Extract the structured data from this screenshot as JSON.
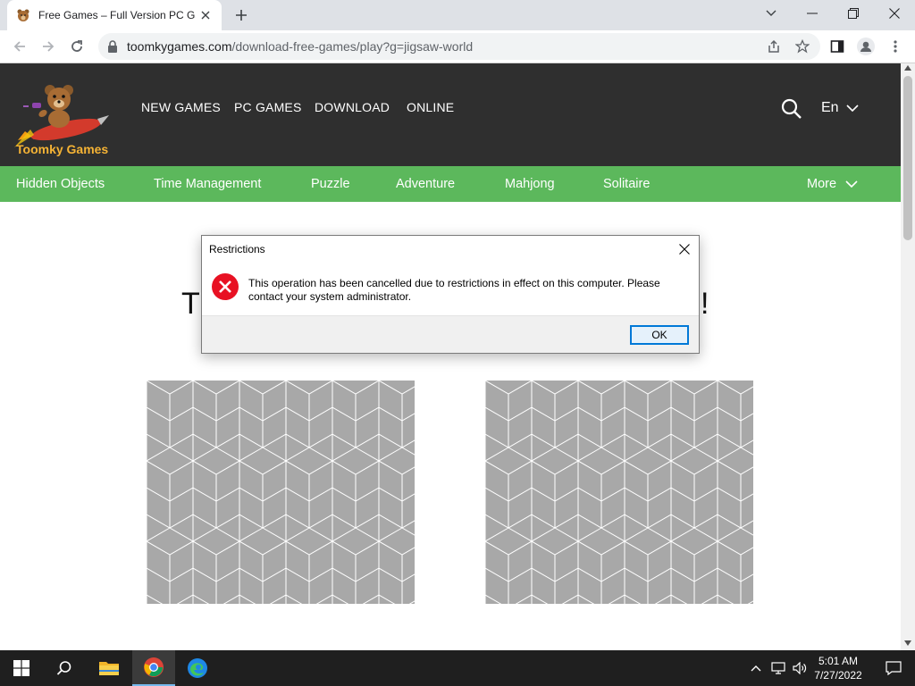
{
  "browser": {
    "tab_title": "Free Games – Full Version PC Ga",
    "url_host": "toomkygames.com",
    "url_path": "/download-free-games/play?g=jigsaw-world"
  },
  "site": {
    "brand": "Toomky Games",
    "top_nav": [
      "NEW GAMES",
      "PC GAMES",
      "DOWNLOAD",
      "ONLINE"
    ],
    "language": "En",
    "categories": [
      "Hidden Objects",
      "Time Management",
      "Puzzle",
      "Adventure",
      "Mahjong",
      "Solitaire"
    ],
    "more_label": "More",
    "heading_left": "T",
    "heading_right": "s!"
  },
  "dialog": {
    "title": "Restrictions",
    "message": "This operation has been cancelled due to restrictions in effect on this computer. Please contact your system administrator.",
    "ok_label": "OK"
  },
  "taskbar": {
    "time": "5:01 AM",
    "date": "7/27/2022"
  },
  "colors": {
    "header_bg": "#2f2f2f",
    "category_bar": "#5cb85c",
    "brand_text": "#f5b335",
    "dialog_error": "#e81123",
    "ok_border": "#0078d7"
  }
}
